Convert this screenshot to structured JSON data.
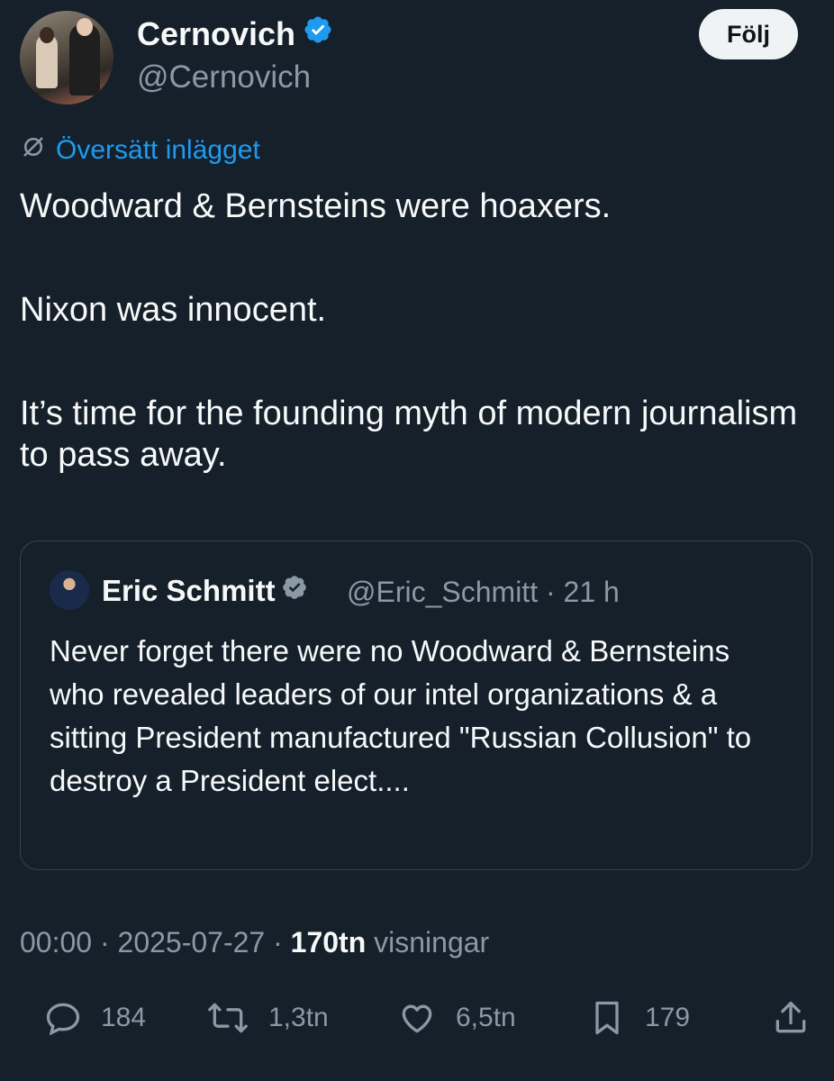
{
  "author": {
    "name": "Cernovich",
    "handle": "@Cernovich",
    "verified": true,
    "verified_color": "#1d9bf0"
  },
  "follow_button": "Följ",
  "translate_link": "Översätt inlägget",
  "tweet": {
    "paragraphs": [
      "Woodward & Bernsteins were hoaxers.",
      "Nixon was innocent.",
      "It’s time for the founding myth of modern journalism to pass away."
    ]
  },
  "quote": {
    "name": "Eric Schmitt",
    "handle": "@Eric_Schmitt",
    "time": "21 h",
    "verified_color": "#8b98a5",
    "text": "Never forget there were no Woodward & Bernsteins who revealed leaders of our intel organizations & a sitting President manufactured \"Russian Collusion\" to destroy a President elect...."
  },
  "meta": {
    "time": "00:00",
    "date": "2025-07-27",
    "views_count": "170tn",
    "views_label": "visningar"
  },
  "actions": {
    "replies": "184",
    "reposts": "1,3tn",
    "likes": "6,5tn",
    "bookmarks": "179"
  },
  "icons": [
    "verified-badge-icon",
    "globe-slash-icon",
    "reply-icon",
    "repost-icon",
    "like-icon",
    "bookmark-icon",
    "share-icon"
  ],
  "colors": {
    "background": "#15202b",
    "accent": "#1d9bf0",
    "secondary_text": "#8b98a5"
  }
}
